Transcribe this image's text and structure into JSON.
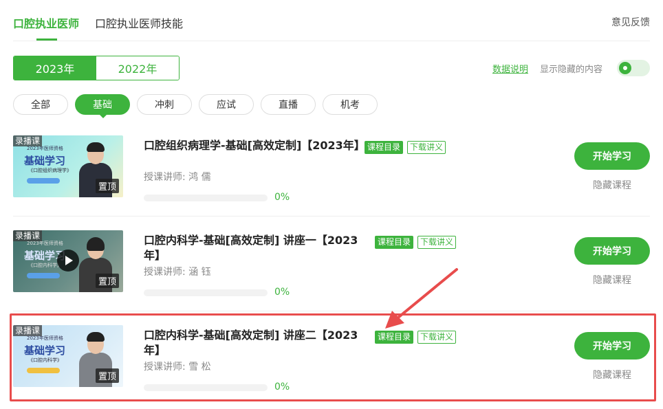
{
  "top_tabs": [
    "口腔执业医师",
    "口腔执业医师技能"
  ],
  "feedback": "意见反馈",
  "years": [
    "2023年",
    "2022年"
  ],
  "data_note": "数据说明",
  "show_hidden_label": "显示隐藏的内容",
  "show_hidden_enabled": true,
  "filters": [
    "全部",
    "基础",
    "冲刺",
    "应试",
    "直播",
    "机考"
  ],
  "active_filter": "基础",
  "accent_color": "#3db33d",
  "highlight_color": "#e84c4c",
  "courses": [
    {
      "thumb": {
        "tag": "录播课",
        "head": "2023年医师资格",
        "title": "基础学习",
        "sub": "《口腔组织病理学》",
        "pin": "置顶"
      },
      "title": "口腔组织病理学-基础[高效定制]【2023年】",
      "catalog": "课程目录",
      "download": "下载讲义",
      "teacher": "授课讲师:  鸿    儒",
      "progress": 0,
      "progress_text": "0%",
      "start": "开始学习",
      "hide": "隐藏课程"
    },
    {
      "thumb": {
        "tag": "录播课",
        "head": "2023年医师资格",
        "title": "基础学习",
        "sub": "《口腔内科学》",
        "pin": "置顶"
      },
      "title": "口腔内科学-基础[高效定制] 讲座一【2023年】",
      "catalog": "课程目录",
      "download": "下载讲义",
      "teacher": "授课讲师:  涵    钰",
      "progress": 0,
      "progress_text": "0%",
      "start": "开始学习",
      "hide": "隐藏课程"
    },
    {
      "thumb": {
        "tag": "录播课",
        "head": "2023年医师资格",
        "title": "基础学习",
        "sub": "《口腔内科学》",
        "pin": "置顶"
      },
      "title": "口腔内科学-基础[高效定制] 讲座二【2023年】",
      "catalog": "课程目录",
      "download": "下载讲义",
      "teacher": "授课讲师:  雪    松",
      "progress": 0,
      "progress_text": "0%",
      "start": "开始学习",
      "hide": "隐藏课程"
    }
  ]
}
